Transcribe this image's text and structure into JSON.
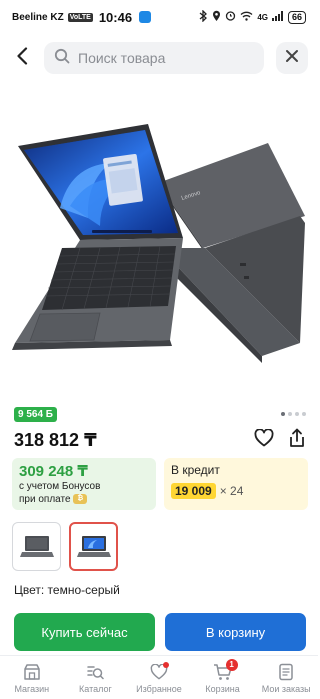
{
  "status_bar": {
    "carrier": "Beeline KZ",
    "volte": "VoLTE",
    "time": "10:46",
    "network": "4G",
    "battery": "66"
  },
  "search": {
    "placeholder": "Поиск товара"
  },
  "product": {
    "points_badge": "9 564 Б",
    "price": "318 812 ₸",
    "gallery_dots": 4,
    "gallery_active_index": 0,
    "bonus_offer": {
      "price": "309 248 ₸",
      "line1": "с учетом Бонусов",
      "line2": "при оплате",
      "coin_icon": "coin-icon"
    },
    "credit_offer": {
      "label": "В кредит",
      "monthly": "19 009",
      "months": "× 24"
    },
    "thumbnails": [
      {
        "name": "thumb-laptop-closed",
        "selected": false
      },
      {
        "name": "thumb-laptop-open",
        "selected": true
      }
    ],
    "color_text": "Цвет: темно-серый"
  },
  "actions": {
    "buy_now": "Купить сейчас",
    "add_to_cart": "В корзину"
  },
  "bottom_nav": [
    {
      "label": "Магазин",
      "icon": "store-icon"
    },
    {
      "label": "Каталог",
      "icon": "catalog-search-icon"
    },
    {
      "label": "Избранное",
      "icon": "heart-icon",
      "dot": true
    },
    {
      "label": "Корзина",
      "icon": "cart-icon",
      "badge": "1"
    },
    {
      "label": "Мои заказы",
      "icon": "orders-icon"
    }
  ],
  "colors": {
    "green": "#22a94f",
    "blue": "#1f6fd6",
    "points_green": "#2db04a",
    "bonus_bg": "#e9f6e7",
    "credit_bg": "#fff8dc",
    "credit_highlight": "#ffd633",
    "alert_red": "#e5302f"
  }
}
